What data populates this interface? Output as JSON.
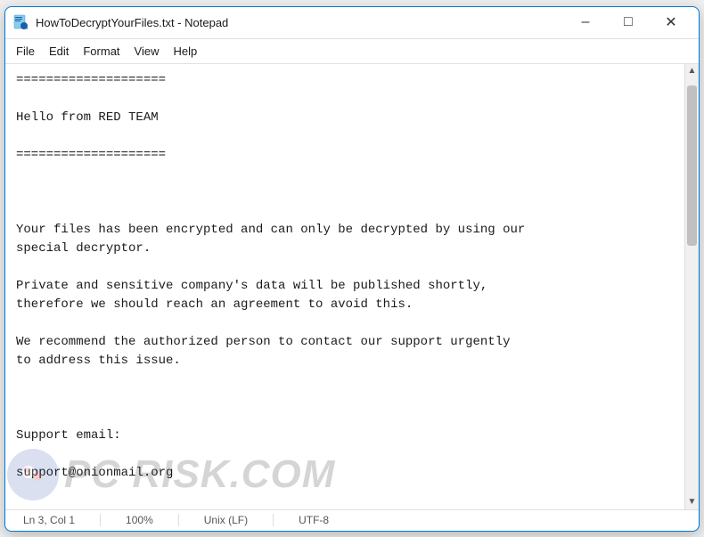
{
  "window": {
    "title": "HowToDecryptYourFiles.txt - Notepad",
    "icon": "notepad"
  },
  "title_controls": {
    "minimize": "–",
    "maximize": "□",
    "close": "✕"
  },
  "menu": {
    "items": [
      "File",
      "Edit",
      "Format",
      "View",
      "Help"
    ]
  },
  "content": {
    "text": "====================\n\nHello from RED TEAM\n\n====================\n\n\n\nYour files has been encrypted and can only be decrypted by using our\nspecial decryptor.\n\nPrivate and sensitive company's data will be published shortly,\ntherefore we should reach an agreement to avoid this.\n\nWe recommend the authorized person to contact our support urgently\nto address this issue.\n\n\n\nSupport email:\n\nsupport@onionmail.org"
  },
  "status_bar": {
    "position": "Ln 3, Col 1",
    "zoom": "100%",
    "line_ending": "Unix (LF)",
    "encoding": "UTF-8"
  },
  "watermark": {
    "text": "PC RISK.COM"
  }
}
